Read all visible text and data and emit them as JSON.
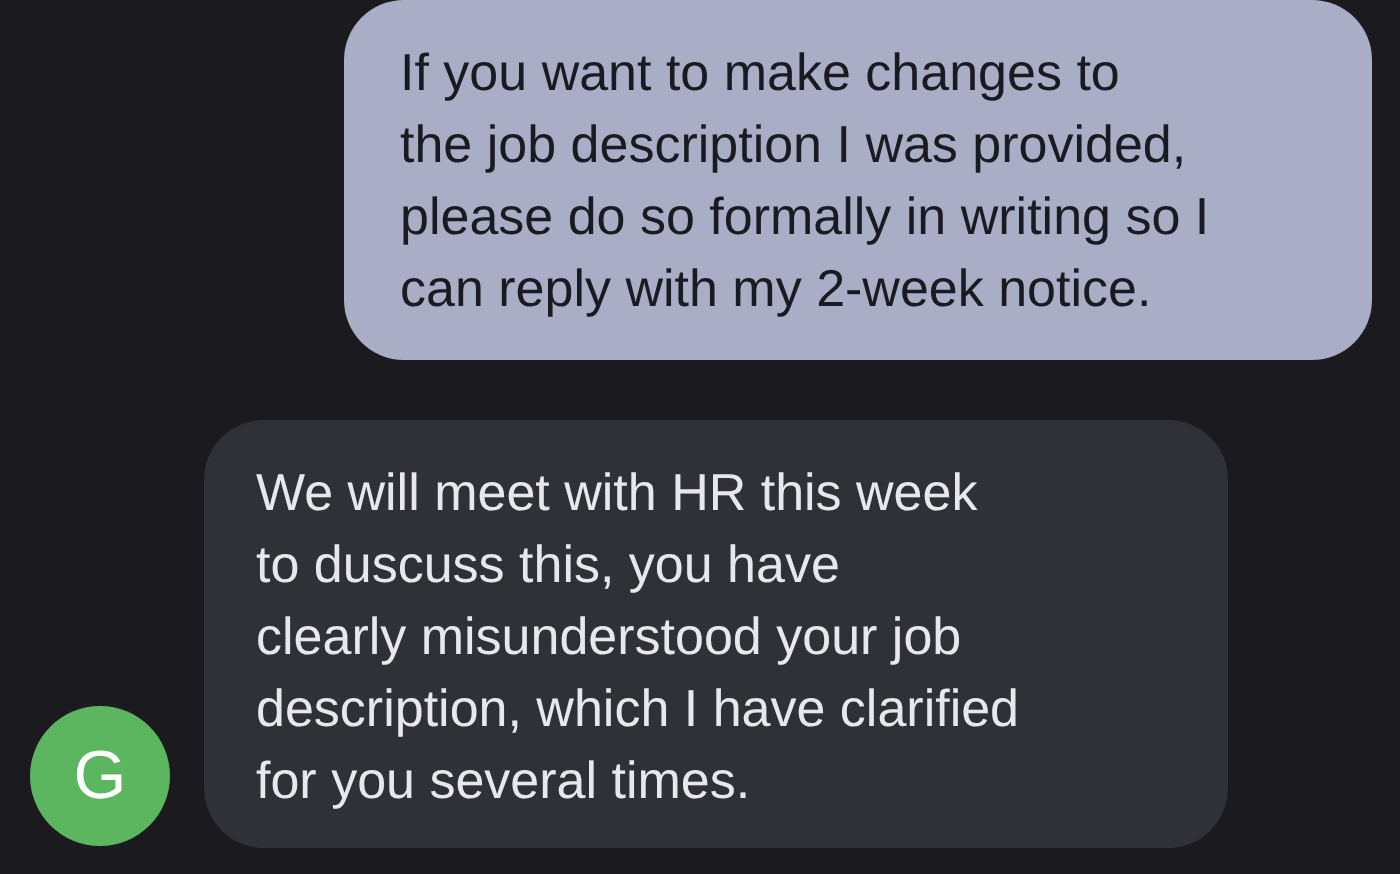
{
  "messages": [
    {
      "kind": "outgoing",
      "text": "If you want to make changes to\nthe job description I was provided,\nplease do so formally in writing so I\ncan reply with my 2-week notice."
    },
    {
      "kind": "incoming",
      "text": "We will meet with HR this week\nto duscuss this, you have\nclearly misunderstood your job\ndescription, which I have clarified\nfor you several times.",
      "avatar": "G"
    }
  ]
}
